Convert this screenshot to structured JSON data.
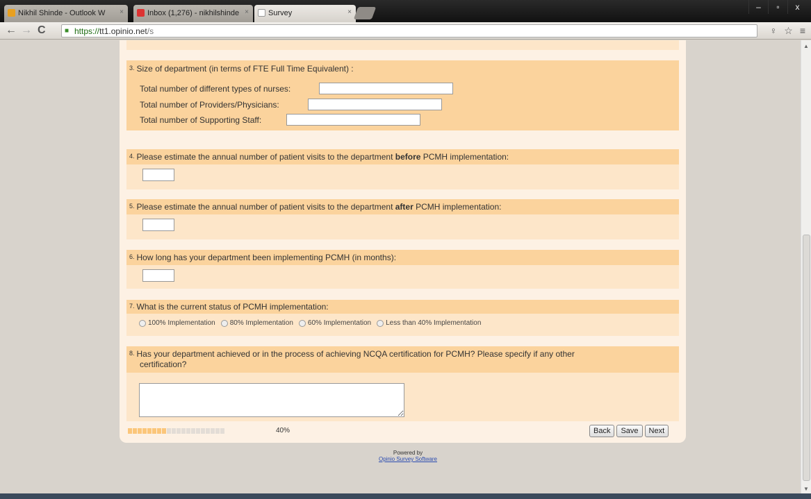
{
  "browser": {
    "tabs": [
      {
        "label": "Nikhil Shinde - Outlook W",
        "icon_color": "#e8a020"
      },
      {
        "label": "Inbox (1,276) - nikhilshinde",
        "icon_color": "#d33"
      },
      {
        "label": "Survey",
        "icon_color": "#fff"
      }
    ],
    "url_scheme": "https://",
    "url_host": "tt1.opinio.net",
    "url_path": "/s"
  },
  "questions": {
    "q3": {
      "number": "3.",
      "text": "Size of department (in terms of FTE Full Time Equivalent) :",
      "fields": [
        {
          "label": "Total number of different types of nurses:",
          "value": ""
        },
        {
          "label": "Total number of Providers/Physicians:",
          "value": ""
        },
        {
          "label": "Total number of Supporting Staff:",
          "value": ""
        }
      ]
    },
    "q4": {
      "number": "4.",
      "pre": "Please estimate the annual number of patient visits to the department ",
      "bold": "before",
      "post": " PCMH implementation:",
      "value": ""
    },
    "q5": {
      "number": "5.",
      "pre": "Please estimate the annual number of patient visits to the department ",
      "bold": "after",
      "post": " PCMH implementation:",
      "value": ""
    },
    "q6": {
      "number": "6.",
      "text": "How long has your department been implementing PCMH (in months):",
      "value": ""
    },
    "q7": {
      "number": "7.",
      "text": "What is the current status of PCMH implementation:",
      "options": [
        "100% Implementation",
        "80% Implementation",
        "60% Implementation",
        "Less than 40% Implementation"
      ]
    },
    "q8": {
      "number": "8.",
      "line1": "Has your department achieved or in the process of achieving NCQA certification for PCMH? Please specify if any other",
      "line2": "certification?",
      "value": ""
    }
  },
  "progress": {
    "percent_label": "40%",
    "fraction": 0.4,
    "segments": 20
  },
  "buttons": {
    "back": "Back",
    "save": "Save",
    "next": "Next"
  },
  "footer": {
    "powered_by": "Powered by",
    "link": "Opinio Survey Software"
  }
}
